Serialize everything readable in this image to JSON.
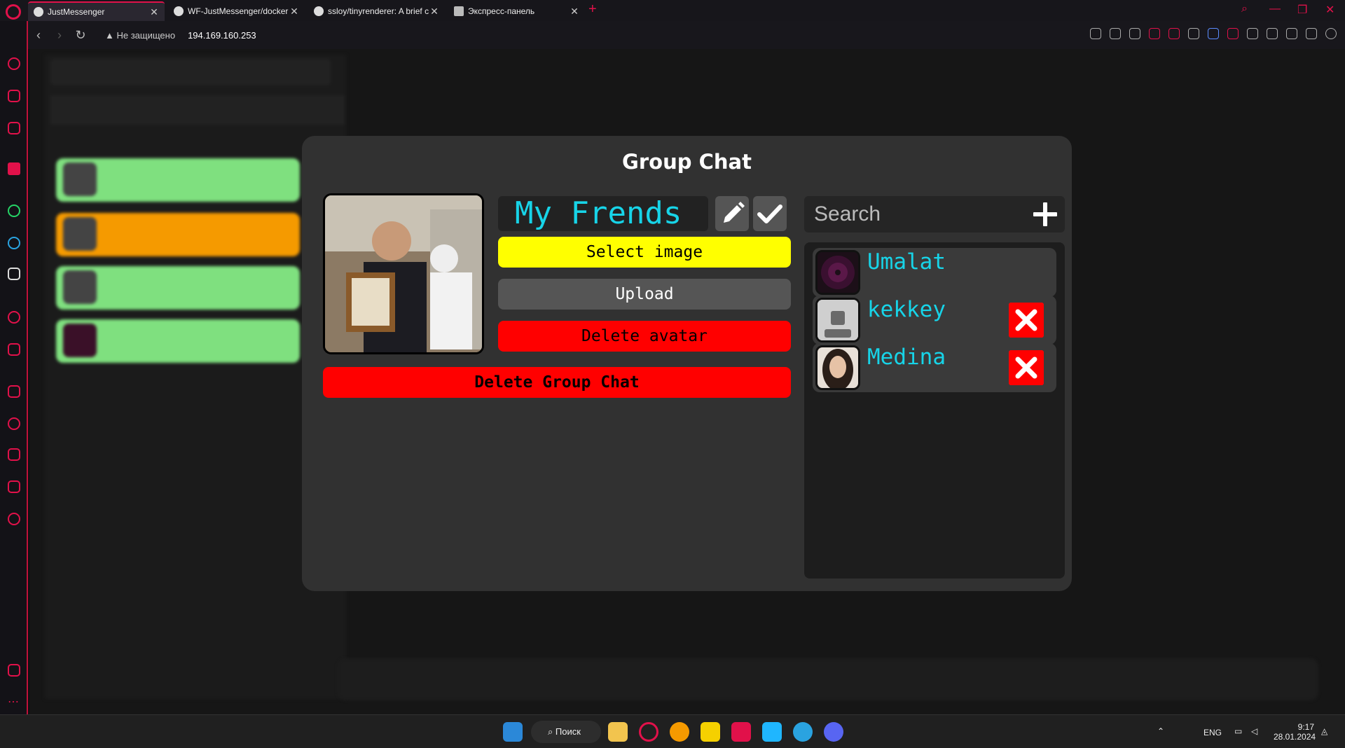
{
  "browser": {
    "tabs": [
      {
        "title": "JustMessenger",
        "active": true
      },
      {
        "title": "WF-JustMessenger/docker",
        "active": false
      },
      {
        "title": "ssloy/tinyrenderer: A brief c",
        "active": false
      },
      {
        "title": "Экспресс-панель",
        "active": false
      }
    ],
    "security_label": "Не защищено",
    "url": "194.169.160.253"
  },
  "modal": {
    "title": "Group Chat",
    "group_name": "My Frends",
    "select_image_label": "Select image",
    "upload_label": "Upload",
    "delete_avatar_label": "Delete avatar",
    "delete_group_label": "Delete Group Chat",
    "search_placeholder": "Search",
    "members": [
      {
        "name": "Umalat",
        "removable": false
      },
      {
        "name": "kekkey",
        "removable": true
      },
      {
        "name": "Medina",
        "removable": true
      }
    ]
  },
  "taskbar": {
    "search_label": "Поиск",
    "language": "ENG",
    "time": "9:17",
    "date": "28.01.2024"
  },
  "colors": {
    "accent": "#e1114a",
    "name_text": "#17d4e8",
    "select_btn": "#ffff00",
    "upload_btn": "#555555",
    "delete_btn": "#ff0000",
    "chat_green": "#7fe07f",
    "chat_orange": "#f59a00"
  }
}
